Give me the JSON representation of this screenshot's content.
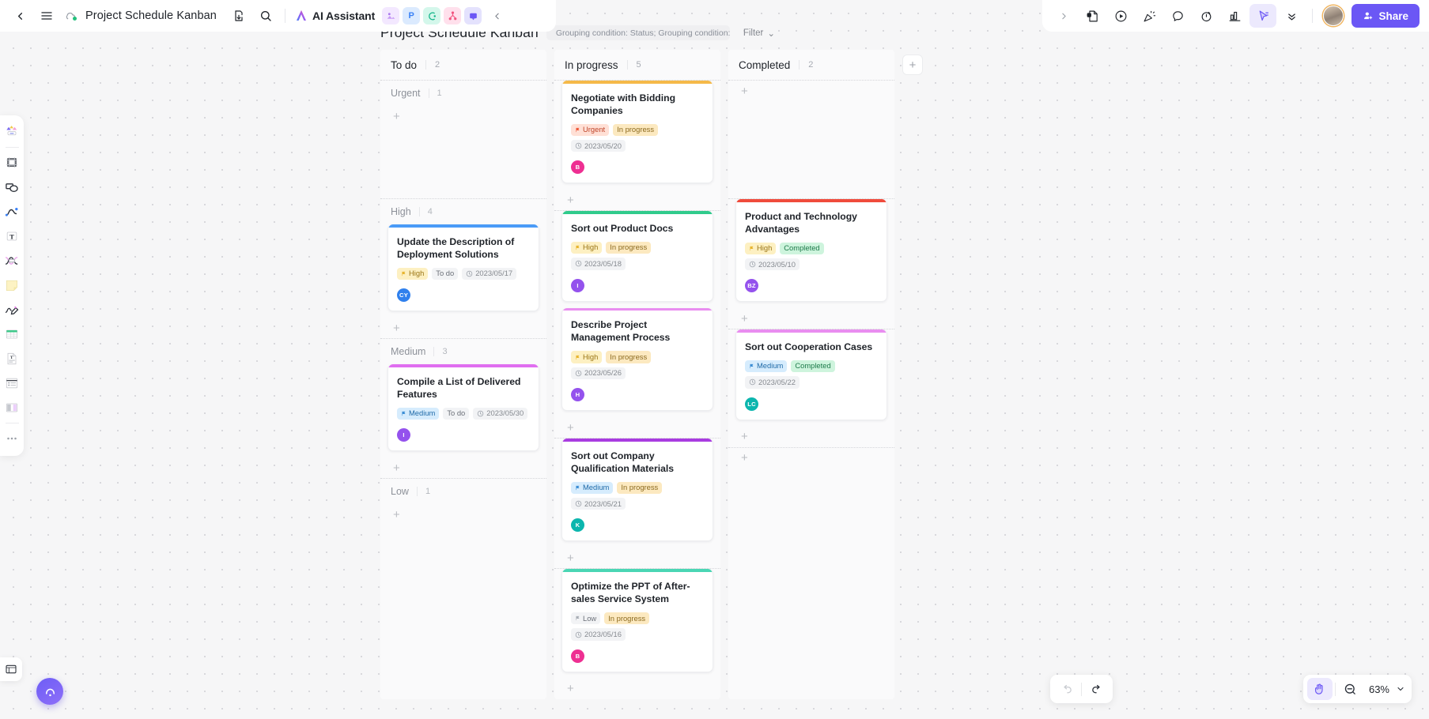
{
  "topbar": {
    "back_icon": "chevron-left-icon",
    "menu_icon": "hamburger-menu-icon",
    "cloud_icon": "cloud-sync-icon",
    "doc_title": "Project Schedule Kanban",
    "export_icon": "download-icon",
    "search_icon": "search-icon",
    "ai_assistant_label": "AI Assistant",
    "apps": [
      {
        "name": "image-app-icon",
        "glyph": "◢",
        "bg": "#f0e6ff",
        "fg": "#a472f0"
      },
      {
        "name": "presentation-app-icon",
        "glyph": "P",
        "bg": "#dbeafe",
        "fg": "#3b82f6"
      },
      {
        "name": "mindmap-app-icon",
        "glyph": "◔",
        "bg": "#d7f7ec",
        "fg": "#18b98a"
      },
      {
        "name": "flowchart-app-icon",
        "glyph": "⑂",
        "bg": "#ffe0ec",
        "fg": "#f2557f"
      },
      {
        "name": "chat-app-icon",
        "glyph": "▣",
        "bg": "#e4e2fd",
        "fg": "#6b57f5"
      }
    ],
    "collapse_icon": "chevron-left-icon",
    "right_icons": [
      {
        "name": "expand-right-icon",
        "glyph": "›"
      },
      {
        "name": "comment-note-icon",
        "glyph": "὜8"
      },
      {
        "name": "present-play-icon",
        "glyph": "▷"
      },
      {
        "name": "celebrate-icon",
        "glyph": "✦"
      },
      {
        "name": "speech-bubble-icon",
        "glyph": "◯"
      },
      {
        "name": "timer-icon",
        "glyph": "⏱"
      },
      {
        "name": "vote-chart-icon",
        "glyph": "Ὄa"
      },
      {
        "name": "cursor-pointer-icon",
        "glyph": "➤"
      },
      {
        "name": "more-chevrons-icon",
        "glyph": "»"
      }
    ],
    "share_label": "Share",
    "share_color": "#6b57f5"
  },
  "left_toolbar": {
    "tools": [
      {
        "name": "shapes-tool",
        "label": "Shapes"
      },
      {
        "name": "frame-tool",
        "label": "Frame"
      },
      {
        "name": "shape-ellipse-tool",
        "label": "Shape"
      },
      {
        "name": "pen-curve-tool",
        "label": "Curve"
      },
      {
        "name": "text-tool",
        "label": "Text"
      },
      {
        "name": "connector-tool",
        "label": "Connector"
      },
      {
        "name": "sticky-note-tool",
        "label": "Sticky note"
      },
      {
        "name": "draw-pencil-tool",
        "label": "Draw"
      },
      {
        "name": "table-tool",
        "label": "Table"
      },
      {
        "name": "document-tool",
        "label": "Document"
      },
      {
        "name": "list-tool",
        "label": "List"
      },
      {
        "name": "layout-tool",
        "label": "Layout"
      },
      {
        "name": "more-tools",
        "label": "More"
      }
    ],
    "file_icon": "file-panel-icon",
    "help_icon": "help-assistant-icon"
  },
  "board": {
    "title": "Project Schedule Kanban",
    "grouping_icon": "grouping-icon",
    "grouping_label": "Grouping condition: Status; Grouping condition: Priority",
    "grouping_caret": "⌄",
    "filter_label": "Filter",
    "filter_caret": "⌄",
    "add_column_label": "+",
    "columns": [
      {
        "name": "To do",
        "count": "2",
        "swimlanes": [
          {
            "name": "Urgent",
            "count": "1",
            "min_height": 150,
            "cards": []
          },
          {
            "name": "High",
            "count": "4",
            "min_height": 0,
            "cards": [
              {
                "title": "Update the Description of Deployment Solutions",
                "stripe": "#4a9bf7",
                "priority": {
                  "label": "High",
                  "bg": "#fdf0c2",
                  "fg": "#9a7515",
                  "flag": "#e8b530"
                },
                "status": {
                  "label": "To do",
                  "bg": "#f2f3f5",
                  "fg": "#6b7078"
                },
                "date": "2023/05/17",
                "avatar": {
                  "initials": "CY",
                  "color": "#2f80ed"
                }
              }
            ]
          },
          {
            "name": "Medium",
            "count": "3",
            "min_height": 0,
            "cards": [
              {
                "title": "Compile a List of Delivered Features",
                "stripe": "#e06ef0",
                "priority": {
                  "label": "Medium",
                  "bg": "#d6ecfd",
                  "fg": "#1f6aa8",
                  "flag": "#3d8fd6"
                },
                "status": {
                  "label": "To do",
                  "bg": "#f2f3f5",
                  "fg": "#6b7078"
                },
                "date": "2023/05/30",
                "avatar": {
                  "initials": "I",
                  "color": "#9452ed"
                }
              }
            ]
          },
          {
            "name": "Low",
            "count": "1",
            "min_height": 95,
            "cards": []
          }
        ]
      },
      {
        "name": "In progress",
        "count": "5",
        "swimlanes": [
          {
            "name": "",
            "count": "",
            "min_height": 0,
            "hide_head": true,
            "cards": [
              {
                "title": "Negotiate with Bidding Companies",
                "stripe": "#f5b949",
                "priority": {
                  "label": "Urgent",
                  "bg": "#ffe0d6",
                  "fg": "#c0452a",
                  "flag": "#ef5a3c"
                },
                "status": {
                  "label": "In progress",
                  "bg": "#fce9c0",
                  "fg": "#8c6a1e"
                },
                "date": "2023/05/20",
                "avatar": {
                  "initials": "B",
                  "color": "#ee2f92"
                }
              }
            ]
          },
          {
            "name": "",
            "count": "",
            "min_height": 0,
            "hide_head": true,
            "cards": [
              {
                "title": "Sort out Product Docs",
                "stripe": "#30cb8c",
                "priority": {
                  "label": "High",
                  "bg": "#fdf0c2",
                  "fg": "#9a7515",
                  "flag": "#e8b530"
                },
                "status": {
                  "label": "In progress",
                  "bg": "#fce9c0",
                  "fg": "#8c6a1e"
                },
                "date": "2023/05/18",
                "avatar": {
                  "initials": "I",
                  "color": "#9452ed"
                }
              },
              {
                "title": "Describe Project Management Process",
                "stripe": "#e98df0",
                "priority": {
                  "label": "High",
                  "bg": "#fdf0c2",
                  "fg": "#9a7515",
                  "flag": "#e8b530"
                },
                "status": {
                  "label": "In progress",
                  "bg": "#fce9c0",
                  "fg": "#8c6a1e"
                },
                "date": "2023/05/26",
                "avatar": {
                  "initials": "H",
                  "color": "#9452ed"
                }
              }
            ]
          },
          {
            "name": "",
            "count": "",
            "min_height": 0,
            "hide_head": true,
            "cards": [
              {
                "title": "Sort out Company Qualification Materials",
                "stripe": "#a93ce0",
                "priority": {
                  "label": "Medium",
                  "bg": "#d6ecfd",
                  "fg": "#1f6aa8",
                  "flag": "#3d8fd6"
                },
                "status": {
                  "label": "In progress",
                  "bg": "#fce9c0",
                  "fg": "#8c6a1e"
                },
                "date": "2023/05/21",
                "avatar": {
                  "initials": "K",
                  "color": "#0cb6ae"
                }
              }
            ]
          },
          {
            "name": "",
            "count": "",
            "min_height": 0,
            "hide_head": true,
            "cards": [
              {
                "title": "Optimize the PPT of After-sales Service System",
                "stripe": "#4ad6b4",
                "priority": {
                  "label": "Low",
                  "bg": "#f2f3f5",
                  "fg": "#6b7078",
                  "flag": "#a9aeb6"
                },
                "status": {
                  "label": "In progress",
                  "bg": "#fce9c0",
                  "fg": "#8c6a1e"
                },
                "date": "2023/05/16",
                "avatar": {
                  "initials": "B",
                  "color": "#ee2f92"
                }
              }
            ]
          }
        ]
      },
      {
        "name": "Completed",
        "count": "2",
        "swimlanes": [
          {
            "name": "",
            "count": "",
            "min_height": 150,
            "hide_head": true,
            "cards": []
          },
          {
            "name": "",
            "count": "",
            "min_height": 0,
            "hide_head": true,
            "cards": [
              {
                "title": "Product and Technology Advantages",
                "stripe": "#f04b3c",
                "priority": {
                  "label": "High",
                  "bg": "#fdf0c2",
                  "fg": "#9a7515",
                  "flag": "#e8b530"
                },
                "status": {
                  "label": "Completed",
                  "bg": "#cef4dd",
                  "fg": "#1d7a4a"
                },
                "date": "2023/05/10",
                "avatar": {
                  "initials": "BZ",
                  "color": "#9452ed"
                }
              }
            ]
          },
          {
            "name": "",
            "count": "",
            "min_height": 0,
            "hide_head": true,
            "cards": [
              {
                "title": "Sort out Cooperation Cases",
                "stripe": "#e98df0",
                "priority": {
                  "label": "Medium",
                  "bg": "#d6ecfd",
                  "fg": "#1f6aa8",
                  "flag": "#3d8fd6"
                },
                "status": {
                  "label": "Completed",
                  "bg": "#cef4dd",
                  "fg": "#1d7a4a"
                },
                "date": "2023/05/22",
                "avatar": {
                  "initials": "LC",
                  "color": "#0cb6ae"
                }
              }
            ]
          },
          {
            "name": "",
            "count": "",
            "min_height": 95,
            "hide_head": true,
            "cards": []
          }
        ]
      }
    ]
  },
  "bottom_bar": {
    "undo_icon": "undo-icon",
    "redo_icon": "redo-icon",
    "hand_icon": "hand-tool-icon",
    "zoom_out_icon": "zoom-out-icon",
    "zoom_level": "63%",
    "zoom_caret": "⌄"
  }
}
